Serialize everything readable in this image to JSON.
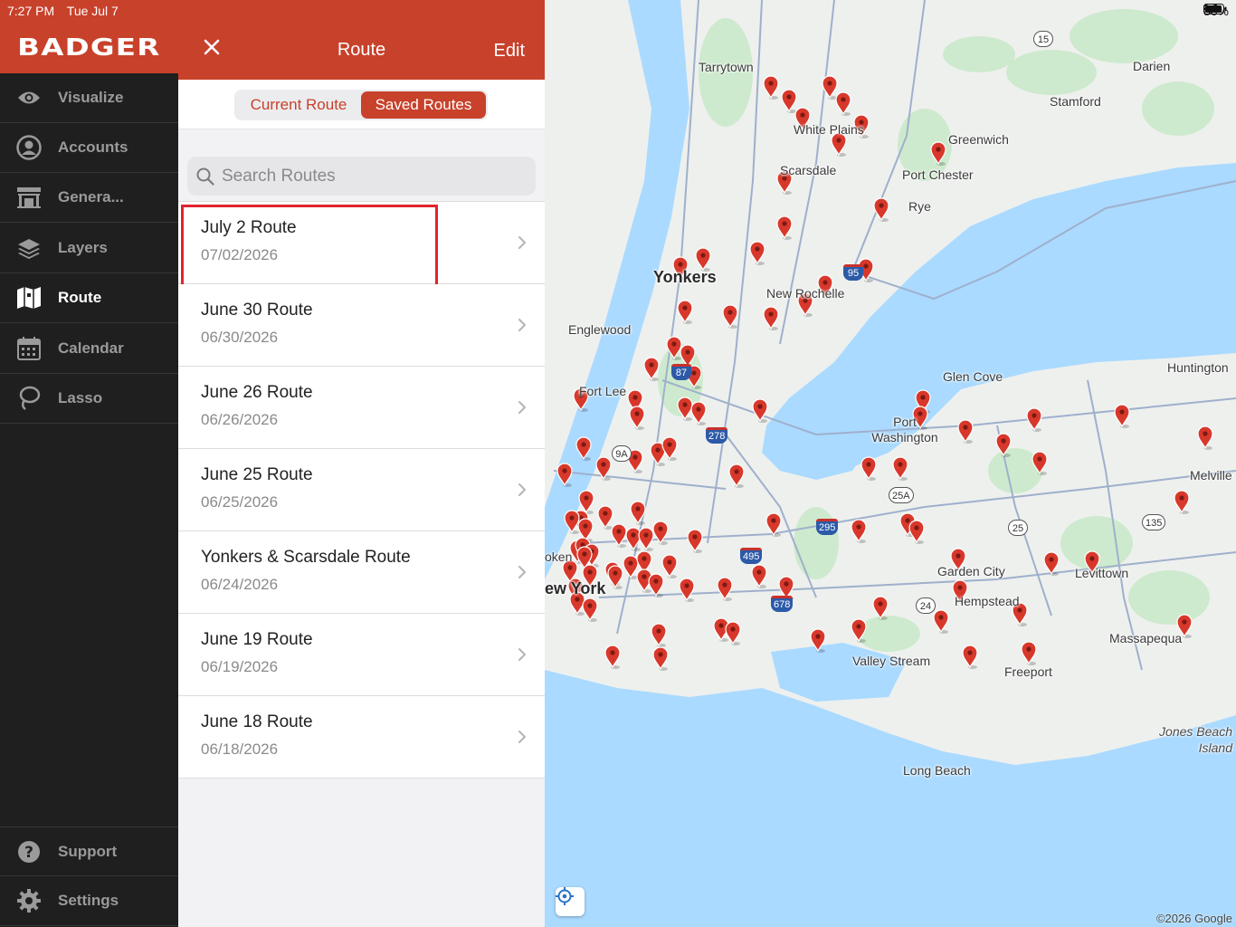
{
  "status": {
    "time": "7:27 PM",
    "date": "Tue Jul 7",
    "battery": "86%"
  },
  "brand": "BADGER",
  "sidebar": {
    "items": [
      {
        "label": "Visualize",
        "icon": "eye-icon"
      },
      {
        "label": "Accounts",
        "icon": "person-icon"
      },
      {
        "label": "Genera...",
        "icon": "storefront-icon"
      },
      {
        "label": "Layers",
        "icon": "layers-icon"
      },
      {
        "label": "Route",
        "icon": "map-icon",
        "active": true
      },
      {
        "label": "Calendar",
        "icon": "calendar-icon"
      },
      {
        "label": "Lasso",
        "icon": "lasso-icon"
      }
    ],
    "bottom": [
      {
        "label": "Support",
        "icon": "question-icon"
      },
      {
        "label": "Settings",
        "icon": "gear-icon"
      }
    ]
  },
  "panel": {
    "title": "Route",
    "edit": "Edit",
    "tabs": [
      "Current Route",
      "Saved Routes"
    ],
    "selected_tab": "Saved Routes",
    "search_placeholder": "Search Routes",
    "routes": [
      {
        "name": "July 2 Route",
        "date": "07/02/2026",
        "highlighted": true
      },
      {
        "name": "June 30 Route",
        "date": "06/30/2026"
      },
      {
        "name": "June 26 Route",
        "date": "06/26/2026"
      },
      {
        "name": "June 25 Route",
        "date": "06/25/2026"
      },
      {
        "name": "Yonkers & Scarsdale Route",
        "date": "06/24/2026"
      },
      {
        "name": "June 19 Route",
        "date": "06/19/2026"
      },
      {
        "name": "June 18 Route",
        "date": "06/18/2026"
      }
    ]
  },
  "map": {
    "labels": [
      "Tarrytown",
      "White Plains",
      "Scarsdale",
      "Yonkers",
      "New Rochelle",
      "Englewood",
      "Fort Lee",
      "Darien",
      "Stamford",
      "Greenwich",
      "Port Chester",
      "Rye",
      "Glen Cove",
      "Huntington",
      "Port Washington",
      "Melville",
      "Garden City",
      "Levittown",
      "Hempstead",
      "Massapequa",
      "Valley Stream",
      "Freeport",
      "Long Beach",
      "Jones Beach Island",
      "ew York",
      "oken"
    ],
    "shields": [
      "15",
      "95",
      "87",
      "278",
      "9A",
      "495",
      "295",
      "678",
      "25",
      "24",
      "25A",
      "135"
    ],
    "copyright": "©2026 Google",
    "colors": {
      "water": "#aadaff",
      "land": "#eef0ee",
      "park": "#c6e8c6",
      "pin": "#d8382b"
    }
  }
}
